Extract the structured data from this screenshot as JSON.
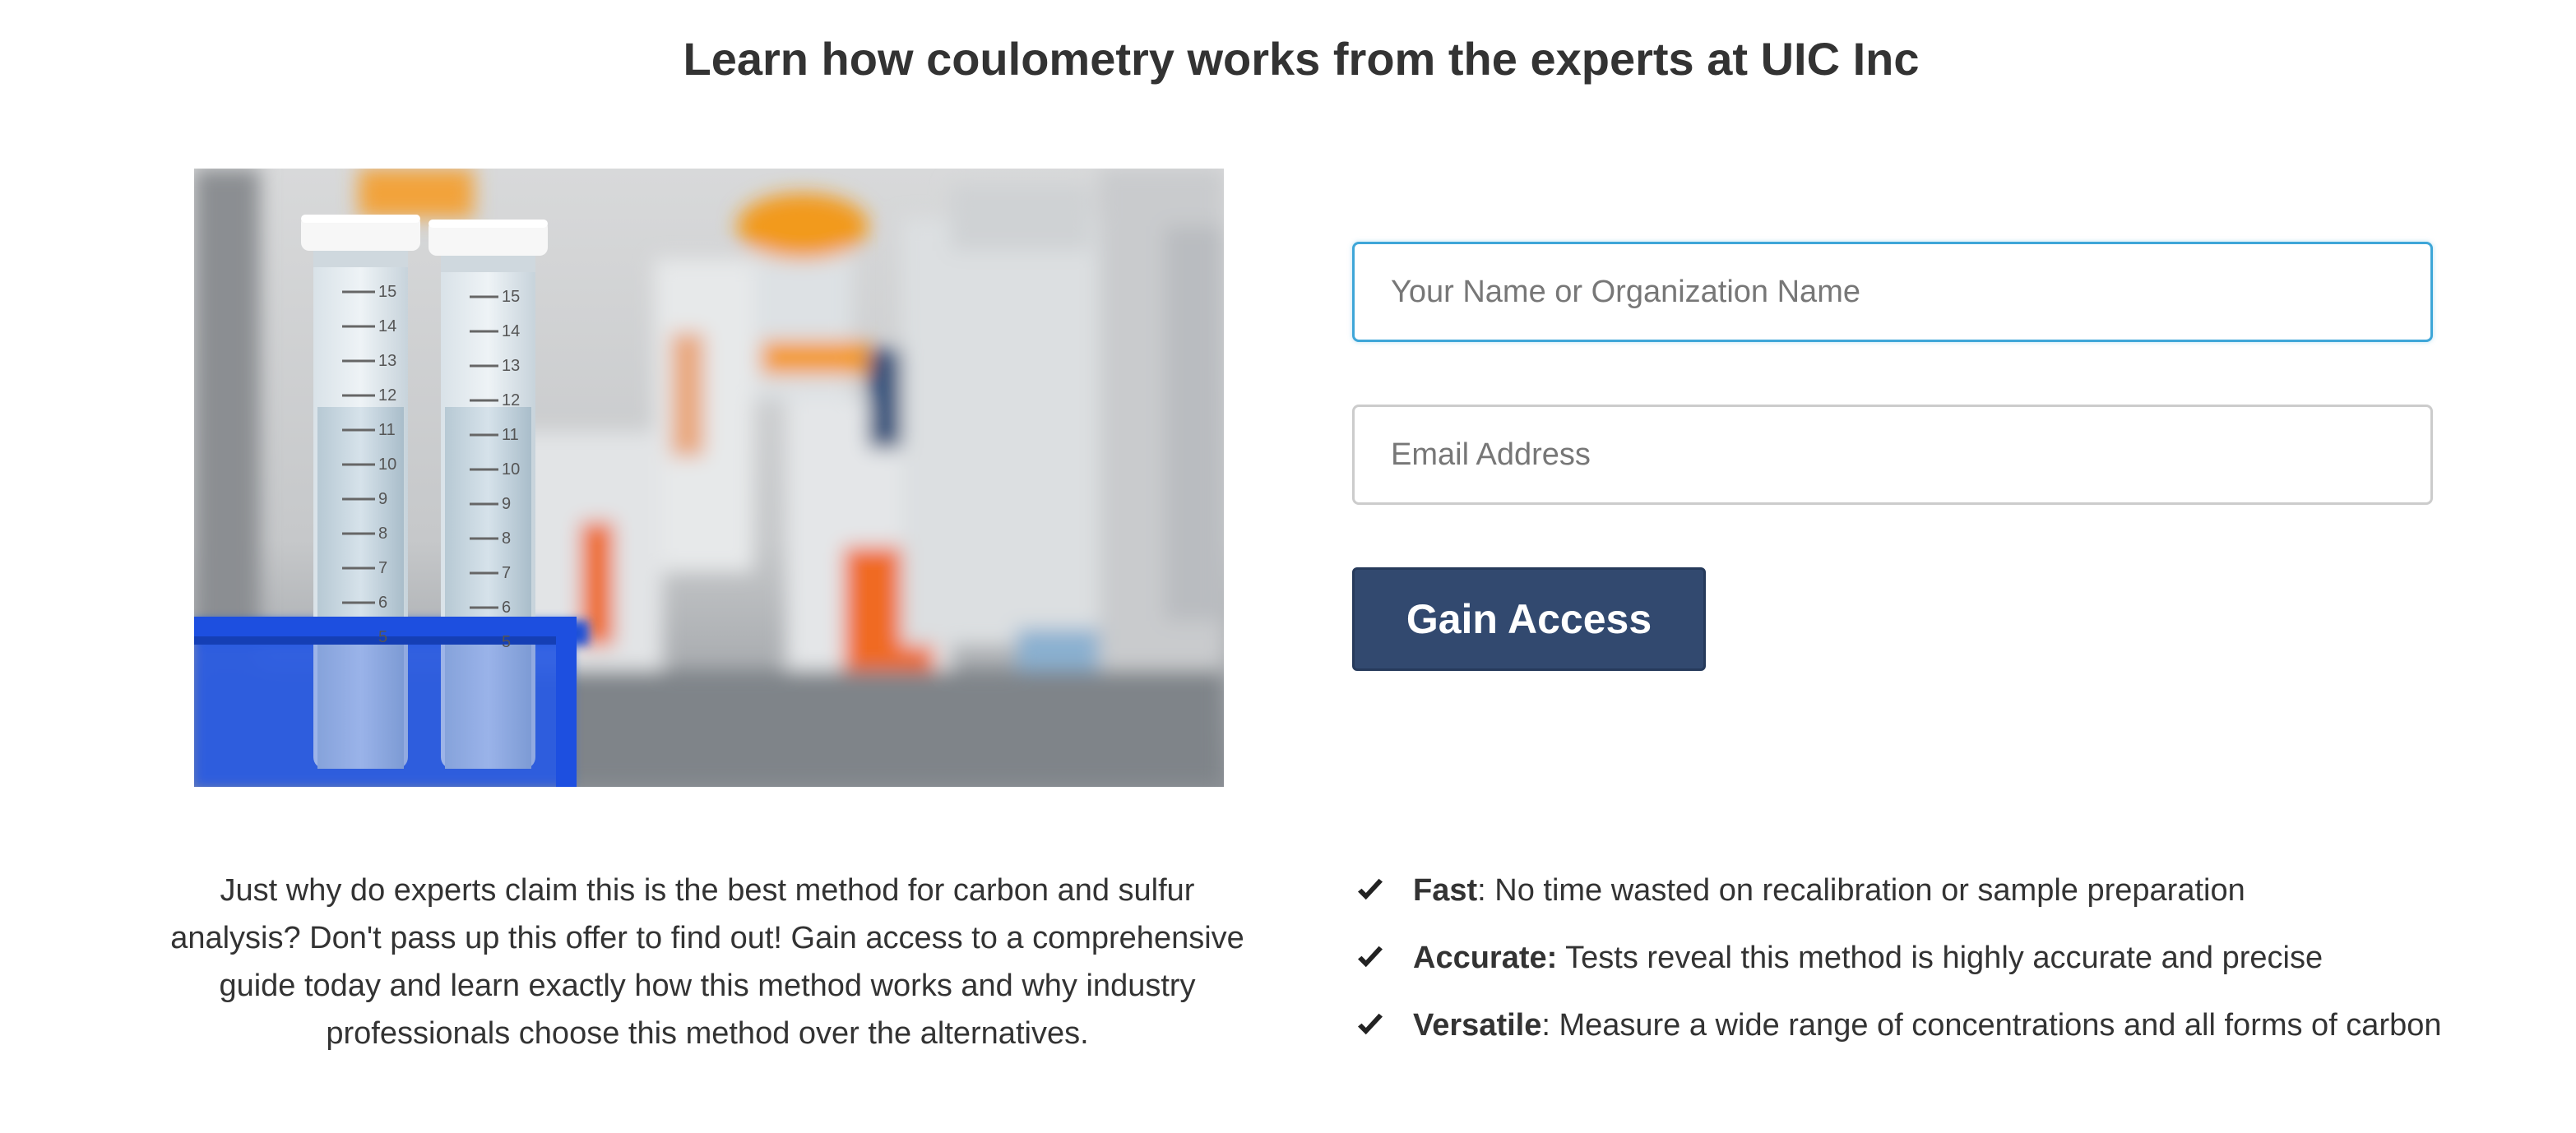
{
  "header": {
    "title": "Learn how coulometry works from the experts at UIC Inc"
  },
  "form": {
    "name_placeholder": "Your Name or Organization Name",
    "email_placeholder": "Email Address",
    "submit_label": "Gain Access"
  },
  "pitch": {
    "text": "Just why do experts claim this is the best method for carbon and sulfur analysis? Don't pass up this offer to find out! Gain access to a comprehensive guide today and learn exactly how this method works and why industry professionals choose this method over the alternatives."
  },
  "benefits": [
    {
      "icon": "check-icon",
      "title": "Fast",
      "separator": ":",
      "text": " No time wasted on recalibration or sample preparation"
    },
    {
      "icon": "check-icon",
      "title": "Accurate:",
      "separator": "",
      "text": " Tests reveal this method is highly accurate and precise"
    },
    {
      "icon": "check-icon",
      "title": "Versatile",
      "separator": ":",
      "text": " Measure a wide range of concentrations and all forms of carbon"
    }
  ],
  "image": {
    "tube_scale_labels": [
      "15",
      "14",
      "13",
      "12",
      "11",
      "10",
      "9",
      "8",
      "7",
      "6",
      "5"
    ]
  },
  "colors": {
    "button": "#32496f",
    "focus_border": "#3ea6d8",
    "rack": "#1f4fd6",
    "cap_orange": "#f5a020"
  }
}
